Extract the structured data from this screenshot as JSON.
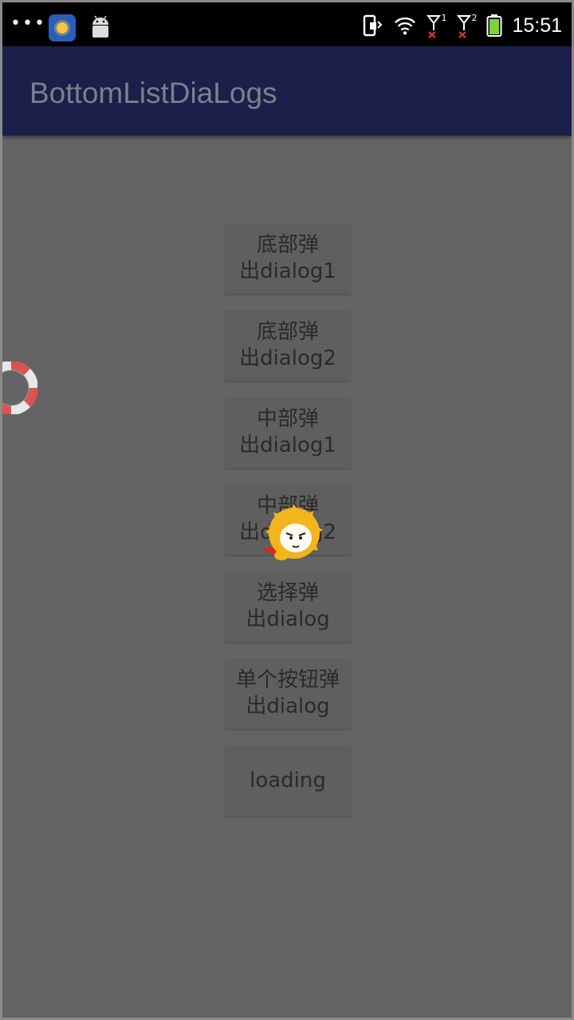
{
  "status_bar": {
    "time": "15:51",
    "icons": [
      "more-dots-icon",
      "sun-app-icon",
      "android-icon",
      "phone-vibrate-icon",
      "wifi-icon",
      "signal-sim1-icon",
      "signal-sim2-icon",
      "battery-icon"
    ],
    "sim1_label": "1",
    "sim2_label": "2"
  },
  "app_bar": {
    "title": "BottomListDiaLogs",
    "background": "#1b1f4a"
  },
  "buttons": [
    {
      "label": "底部弹\n出dialog1"
    },
    {
      "label": "底部弹\n出dialog2"
    },
    {
      "label": "中部弹\n出dialog1"
    },
    {
      "label": "中部弹\n出dialog2"
    },
    {
      "label": "选择弹\n出dialog"
    },
    {
      "label": "单个按钮弹\n出dialog"
    },
    {
      "label": "loading"
    }
  ],
  "overlays": {
    "floating_widget": "lifebuoy-icon",
    "loading_mascot": "mascot-icon"
  }
}
